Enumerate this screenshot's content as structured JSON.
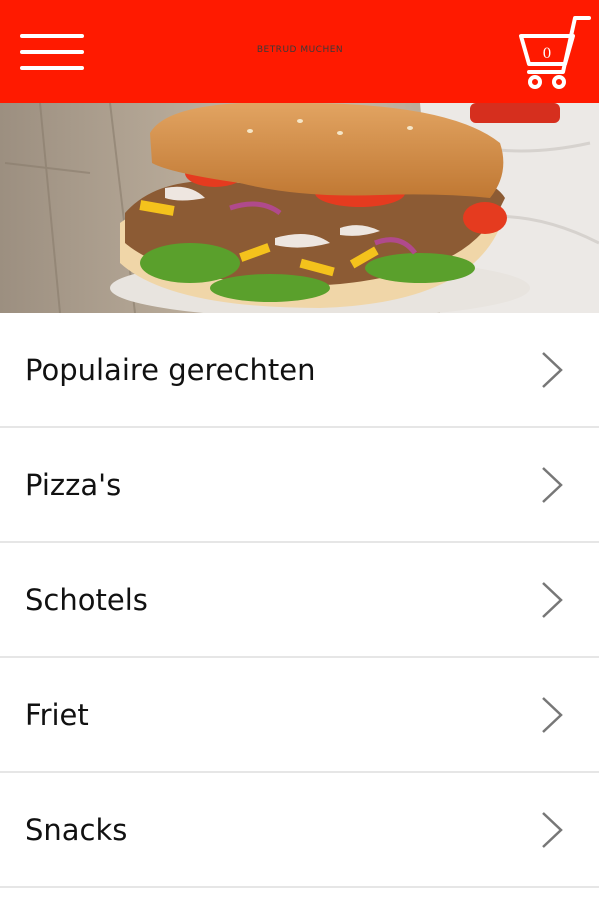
{
  "header": {
    "brand": "BETRUD MUCHEN",
    "background_color": "#ff1a00",
    "menu_icon": "hamburger-menu-icon",
    "cart_icon": "shopping-cart-icon",
    "cart_count": "0"
  },
  "hero": {
    "image": "food-photo-doner-kebab-sandwich"
  },
  "menu": {
    "chevron_icon": "chevron-right-icon",
    "items": [
      {
        "label": "Populaire gerechten"
      },
      {
        "label": "Pizza's"
      },
      {
        "label": "Schotels"
      },
      {
        "label": "Friet"
      },
      {
        "label": "Snacks"
      }
    ]
  }
}
